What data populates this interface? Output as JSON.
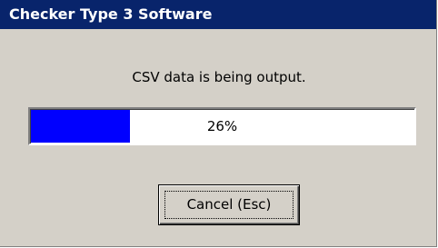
{
  "window": {
    "title": "Checker Type 3 Software"
  },
  "dialog": {
    "message": "CSV data is being output."
  },
  "progress": {
    "value": 0.26,
    "label": "26%"
  },
  "buttons": {
    "cancel_label": "Cancel (Esc)"
  },
  "colors": {
    "titlebar": "#08246b",
    "progress_fill": "#0000ff",
    "dialog_bg": "#d4d0c8"
  }
}
